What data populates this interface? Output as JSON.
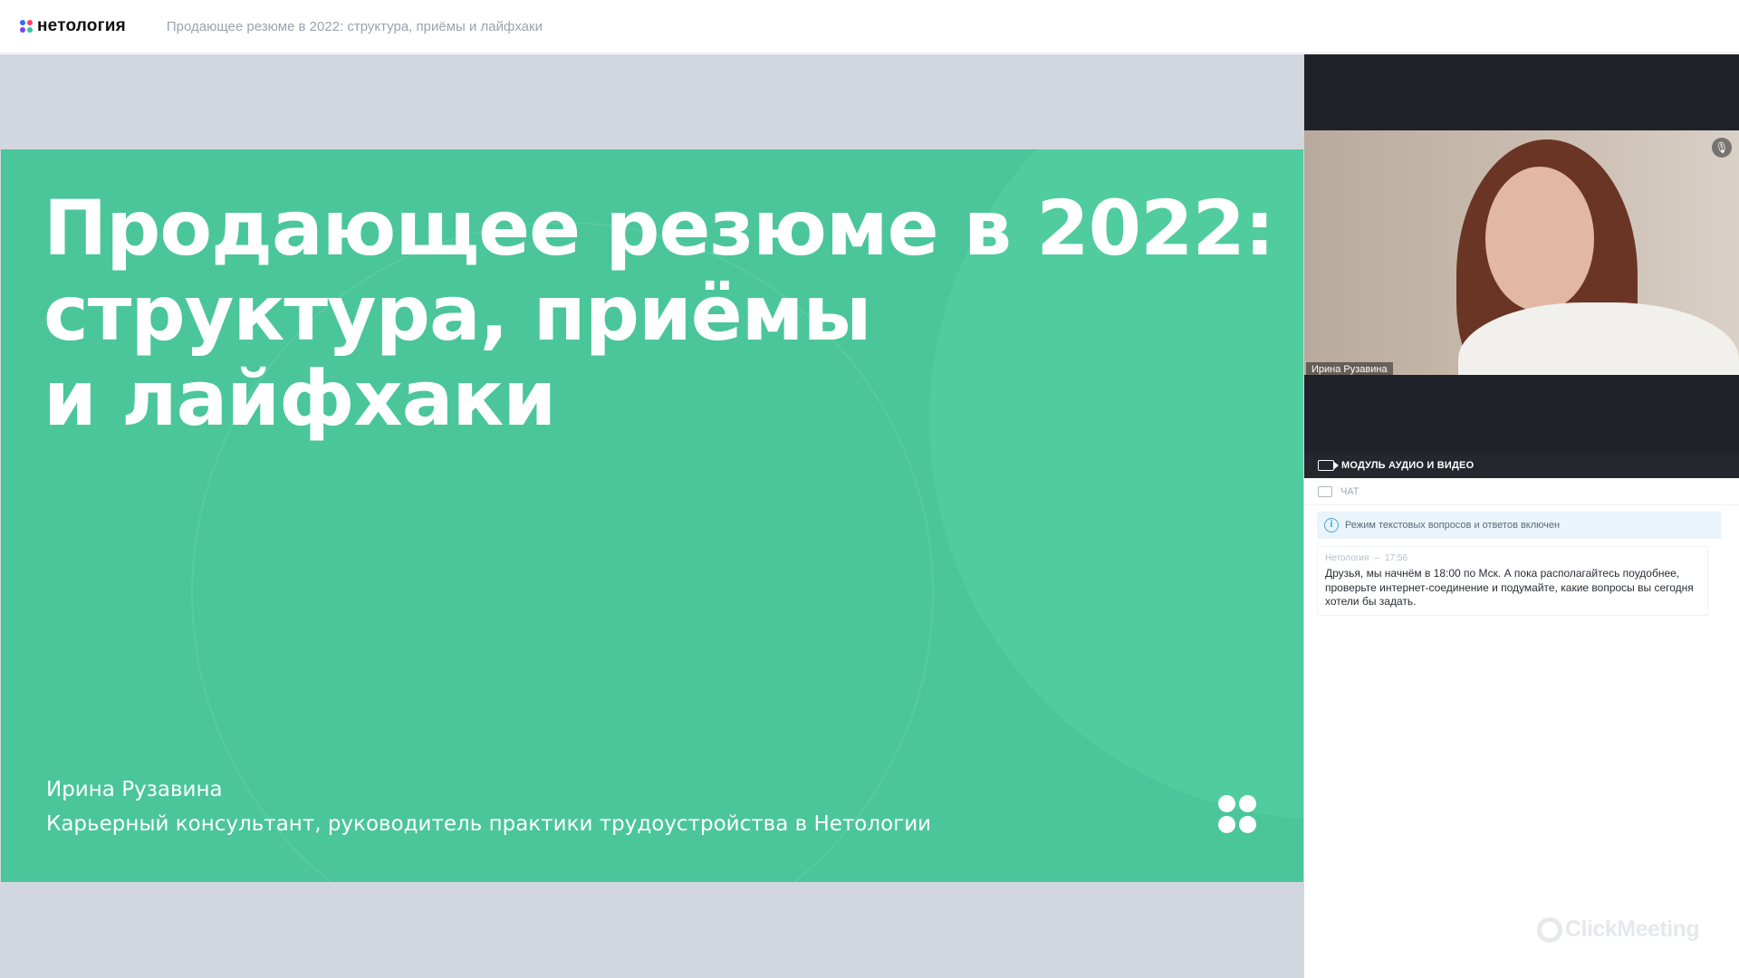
{
  "header": {
    "logo_text": "нетология",
    "webinar_title": "Продающее резюме в 2022: структура, приёмы и лайфхаки"
  },
  "slide": {
    "title_lines": [
      "Продающее резюме в 2022:",
      "структура, приёмы",
      "и лайфхаки"
    ],
    "author": "Ирина Рузавина",
    "role": "Карьерный консультант, руководитель практики трудоустройства в Нетологии",
    "background_color": "#4ac69a"
  },
  "video": {
    "participant_name": "Ирина Рузавина",
    "mic_icon": "mic-icon"
  },
  "panels": {
    "av_module_label": "МОДУЛЬ АУДИО И ВИДЕО",
    "chat_label": "ЧАТ"
  },
  "chat": {
    "notice": "Режим текстовых вопросов и ответов включен",
    "messages": [
      {
        "author": "Нетология",
        "time": "17:56",
        "text": "Друзья, мы начнём в 18:00 по Мск. А пока располагайтесь поудобнее, проверьте интернет-соединение и подумайте, какие вопросы вы сегодня хотели бы задать."
      }
    ]
  },
  "watermark": {
    "text": "ClickMeeting"
  }
}
